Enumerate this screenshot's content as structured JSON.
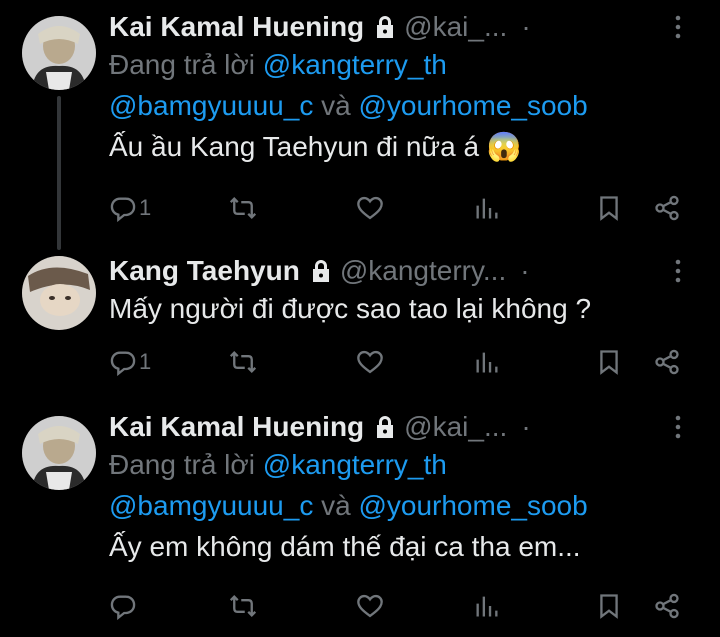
{
  "tweets": [
    {
      "name": "Kai Kamal Huening",
      "handle": "@kai_...",
      "reply_prefix": "Đang trả lời",
      "reply_user1": "@kangterry_th",
      "reply_user2": "@bamgyuuuu_c",
      "reply_and": "và",
      "reply_user3": "@yourhome_soob",
      "text": "Ấu ầu Kang Taehyun đi nữa á 😱",
      "reply_count": "1"
    },
    {
      "name": "Kang Taehyun",
      "handle": "@kangterry...",
      "text": "Mấy người đi được sao tao lại không ?",
      "reply_count": "1"
    },
    {
      "name": "Kai Kamal Huening",
      "handle": "@kai_...",
      "reply_prefix": "Đang trả lời",
      "reply_user1": "@kangterry_th",
      "reply_user2": "@bamgyuuuu_c",
      "reply_and": "và",
      "reply_user3": "@yourhome_soob",
      "text": "Ấy em không dám thế đại ca tha em...",
      "reply_count": ""
    }
  ],
  "separator": "·",
  "colors": {
    "background": "#000000",
    "text": "#e7e9ea",
    "muted": "#71767b",
    "link": "#1d9bf0"
  },
  "icons": [
    "lock-icon",
    "more-icon",
    "reply-icon",
    "retweet-icon",
    "like-icon",
    "views-icon",
    "bookmark-icon",
    "share-icon"
  ]
}
